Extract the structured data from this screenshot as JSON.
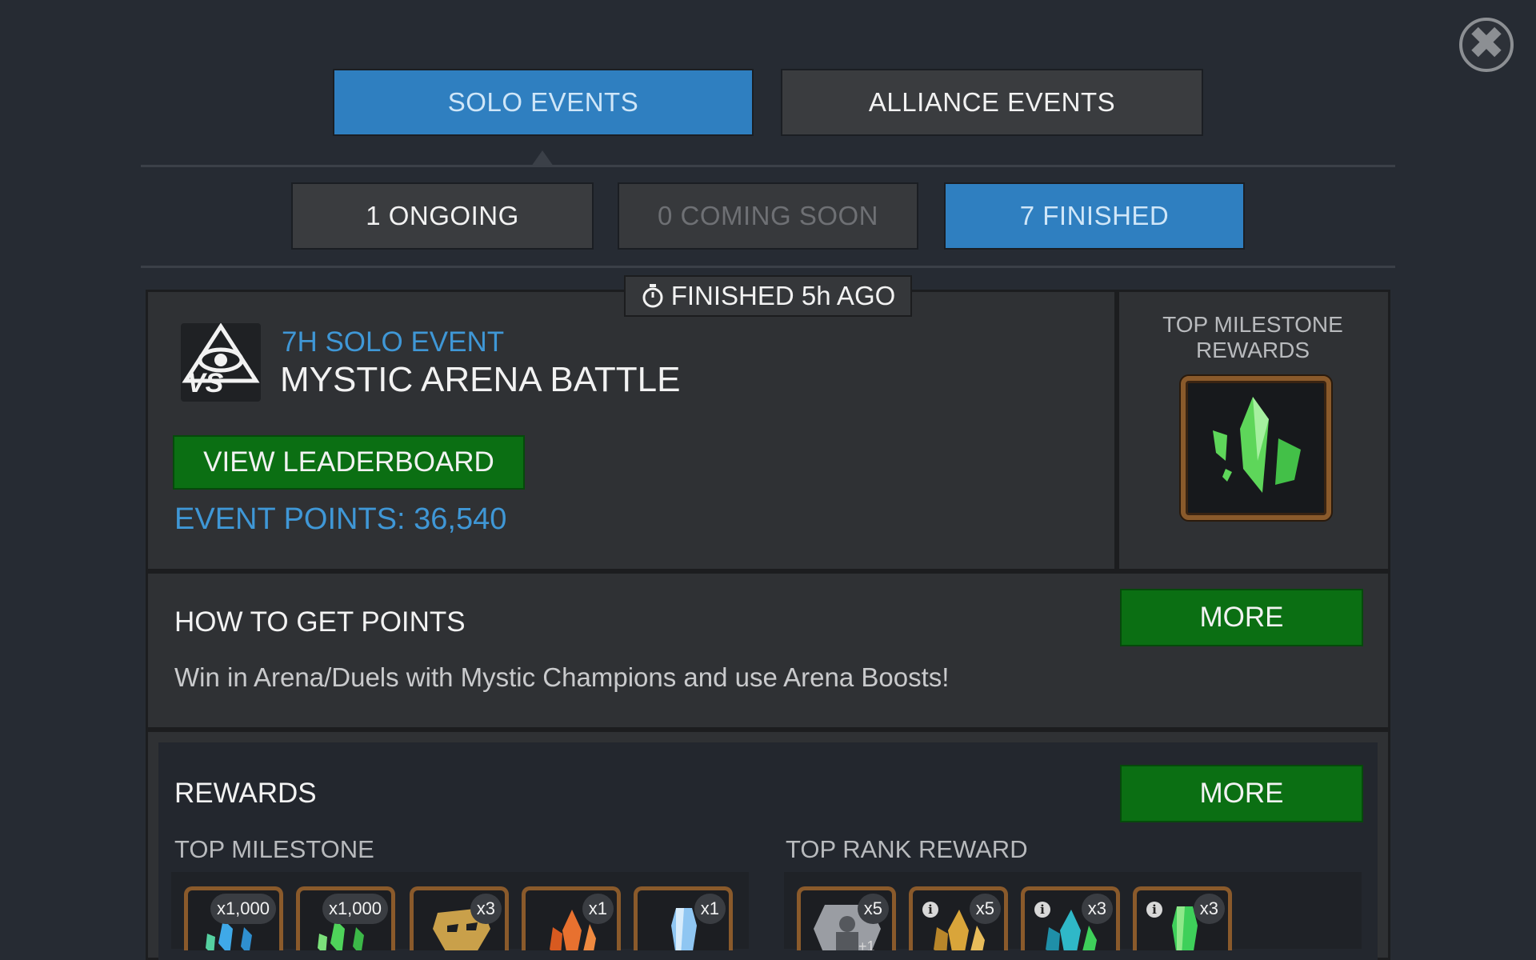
{
  "close": {
    "label": "✖"
  },
  "top_tabs": [
    {
      "label": "SOLO EVENTS",
      "state": "active"
    },
    {
      "label": "ALLIANCE EVENTS",
      "state": "inactive"
    }
  ],
  "sub_tabs": [
    {
      "label": "1 ONGOING",
      "state": "inactive"
    },
    {
      "label": "0 COMING SOON",
      "state": "disabled"
    },
    {
      "label": "7 FINISHED",
      "state": "active"
    }
  ],
  "event": {
    "finished_label": "FINISHED 5h AGO",
    "type_label": "7H SOLO EVENT",
    "title": "MYSTIC ARENA BATTLE",
    "icon_text": "VS",
    "leaderboard_button": "VIEW LEADERBOARD",
    "points_label": "EVENT POINTS: 36,540"
  },
  "milestone_card": {
    "title_line1": "TOP MILESTONE",
    "title_line2": "REWARDS"
  },
  "how_to": {
    "title": "HOW TO GET POINTS",
    "more_button": "MORE",
    "description": "Win in Arena/Duels with Mystic Champions and use Arena Boosts!"
  },
  "rewards": {
    "title": "REWARDS",
    "more_button": "MORE",
    "top_milestone_label": "TOP MILESTONE",
    "top_rank_label": "TOP RANK REWARD",
    "milestone_items": [
      {
        "qty": "x1,000",
        "icon": "blue-crystal-shards-icon",
        "color": "#3fa9e8"
      },
      {
        "qty": "x1,000",
        "icon": "green-crystal-shards-icon",
        "color": "#4fd35a"
      },
      {
        "qty": "x3",
        "icon": "gold-mask-icon",
        "color": "#c9a04a"
      },
      {
        "qty": "x1",
        "icon": "orange-crystal-icon",
        "color": "#e8712f"
      },
      {
        "qty": "x1",
        "icon": "blue-gem-icon",
        "color": "#8fc6f2"
      }
    ],
    "rank_items": [
      {
        "qty": "x5",
        "icon": "silver-champion-icon",
        "color": "#9a9da3",
        "info": false,
        "extra": "+1"
      },
      {
        "qty": "x5",
        "icon": "gold-crystal-icon",
        "color": "#d9a53a",
        "info": true
      },
      {
        "qty": "x3",
        "icon": "teal-crystal-icon",
        "color": "#2fb8c8",
        "info": true
      },
      {
        "qty": "x3",
        "icon": "green-crystal-icon",
        "color": "#3ed05a",
        "info": true
      }
    ],
    "info_glyph": "i"
  }
}
